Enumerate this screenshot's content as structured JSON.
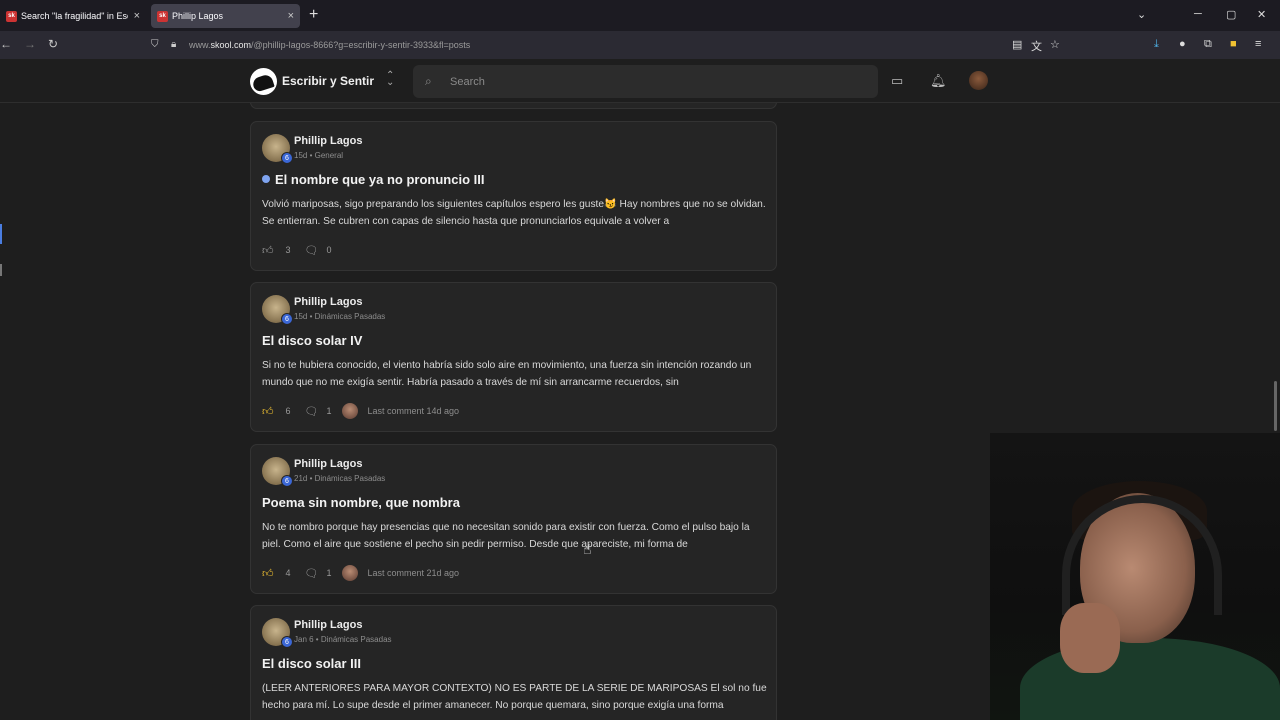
{
  "browser": {
    "tabs": [
      {
        "favicon": "sk",
        "title": "Search \"la fragilidad\" in Escribir"
      },
      {
        "favicon": "sk",
        "title": "Phillip Lagos"
      }
    ],
    "url_prefix": "www.",
    "url_domain": "skool.com",
    "url_rest": "/@phillip-lagos-8666?g=escribir-y-sentir-3933&fl=posts"
  },
  "header": {
    "community_name": "Escribir y Sentir",
    "search_placeholder": "Search"
  },
  "posts": [
    {
      "author": "Phillip Lagos",
      "level": "6",
      "meta": "15d • General",
      "title": "El nombre que ya no pronuncio III",
      "unread": true,
      "body": "Volvió mariposas, sigo preparando los siguientes capítulos espero les guste😼 Hay nombres que no se olvidan. Se entierran. Se cubren con capas de silencio hasta que pronunciarlos equivale a volver a",
      "likes": "3",
      "liked": false,
      "comments": "0",
      "last_comment": ""
    },
    {
      "author": "Phillip Lagos",
      "level": "6",
      "meta": "15d • Dinámicas Pasadas",
      "title": "El disco solar IV",
      "unread": false,
      "body": "Si no te hubiera conocido, el viento habría sido solo aire en movimiento, una fuerza sin intención rozando un mundo que no me exigía sentir. Habría pasado a través de mí sin arrancarme recuerdos, sin",
      "likes": "6",
      "liked": true,
      "comments": "1",
      "last_comment": "Last comment 14d ago"
    },
    {
      "author": "Phillip Lagos",
      "level": "6",
      "meta": "21d • Dinámicas Pasadas",
      "title": "Poema sin nombre, que nombra",
      "unread": false,
      "body": "No te nombro porque hay presencias que no necesitan sonido para existir con fuerza. Como el pulso bajo la piel. Como el aire que sostiene el pecho sin pedir permiso. Desde que apareciste, mi forma de",
      "likes": "4",
      "liked": true,
      "comments": "1",
      "last_comment": "Last comment 21d ago"
    },
    {
      "author": "Phillip Lagos",
      "level": "6",
      "meta": "Jan 6 • Dinámicas Pasadas",
      "title": "El disco solar III",
      "unread": false,
      "body": "(LEER ANTERIORES PARA MAYOR CONTEXTO) NO ES PARTE DE LA SERIE DE MARIPOSAS El sol no fue hecho para mí. Lo supe desde el primer amanecer. No porque quemara, sino porque exigía una forma",
      "likes": "",
      "liked": false,
      "comments": "",
      "last_comment": ""
    }
  ]
}
